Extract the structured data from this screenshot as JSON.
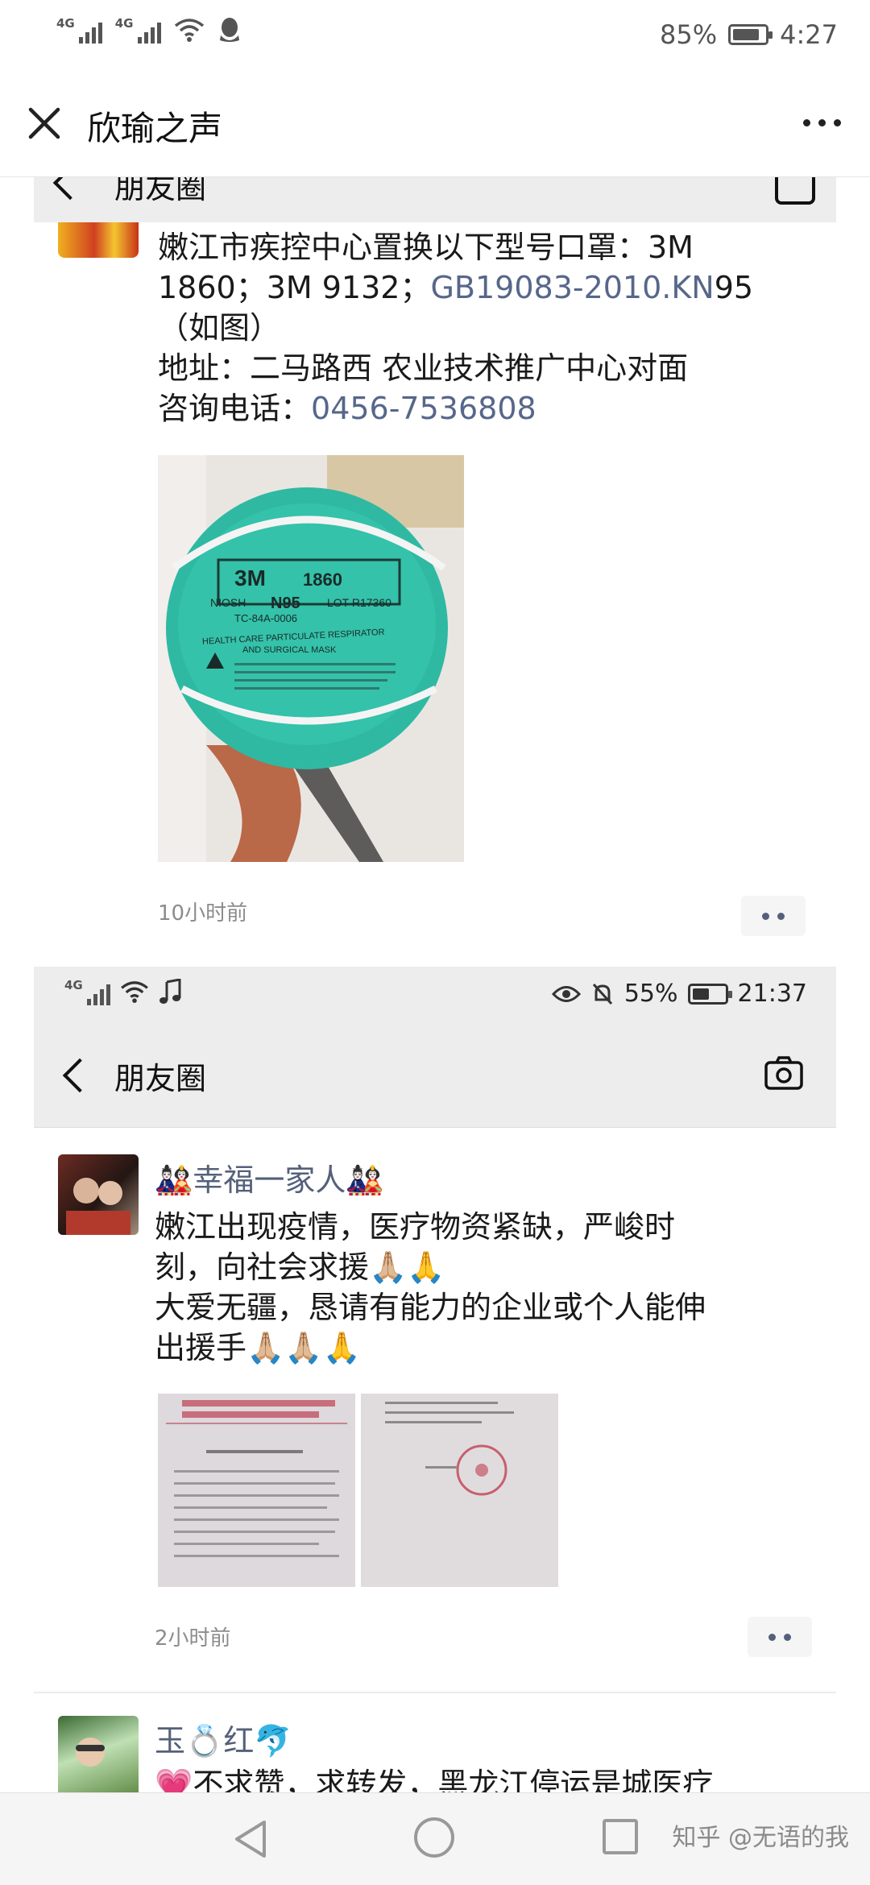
{
  "status_bar": {
    "signal1": "4G",
    "signal2": "4G",
    "battery": "85%",
    "battery_level": 0.85,
    "time": "4:27"
  },
  "header": {
    "title": "欣瑜之声"
  },
  "post1": {
    "nav_label": "朋友圈",
    "lines": [
      "嫩江市疾控中心置换以下型号口罩：3M",
      "1860；3M 9132；",
      "GB19083-2010.KN",
      "95",
      "（如图）",
      "地址：二马路西 农业技术推广中心对面",
      "咨询电话：",
      "0456-7536808"
    ],
    "mask_text": {
      "brand": "3M",
      "model": "1860",
      "niosh": "NIOSH",
      "rating": "N95",
      "lot": "LOT R17360",
      "approval": "TC-84A-0006",
      "desc1": "HEALTH CARE PARTICULATE RESPIRATOR",
      "desc2": "AND SURGICAL MASK"
    },
    "time": "10小时前"
  },
  "inner_status": {
    "signal": "4G",
    "battery": "55%",
    "battery_level": 0.55,
    "time": "21:37"
  },
  "inner_nav": {
    "label": "朋友圈"
  },
  "post2": {
    "nickname": "🎎幸福一家人🎎",
    "lines": [
      "嫩江出现疫情，医疗物资紧缺，严峻时",
      "刻，向社会求援🙏🏼🙏",
      "大爱无疆，恳请有能力的企业或个人能伸",
      "出援手🙏🏼🙏🏼🙏"
    ],
    "time": "2小时前"
  },
  "post3": {
    "nickname": "玉💍红🐬",
    "line": "💗不求赞，求转发，黑龙江停运是城医疗"
  },
  "watermark": "知乎 @无语的我",
  "colors": {
    "link": "#57678a",
    "nick": "#55607a",
    "mask": "#2fb9a2"
  }
}
